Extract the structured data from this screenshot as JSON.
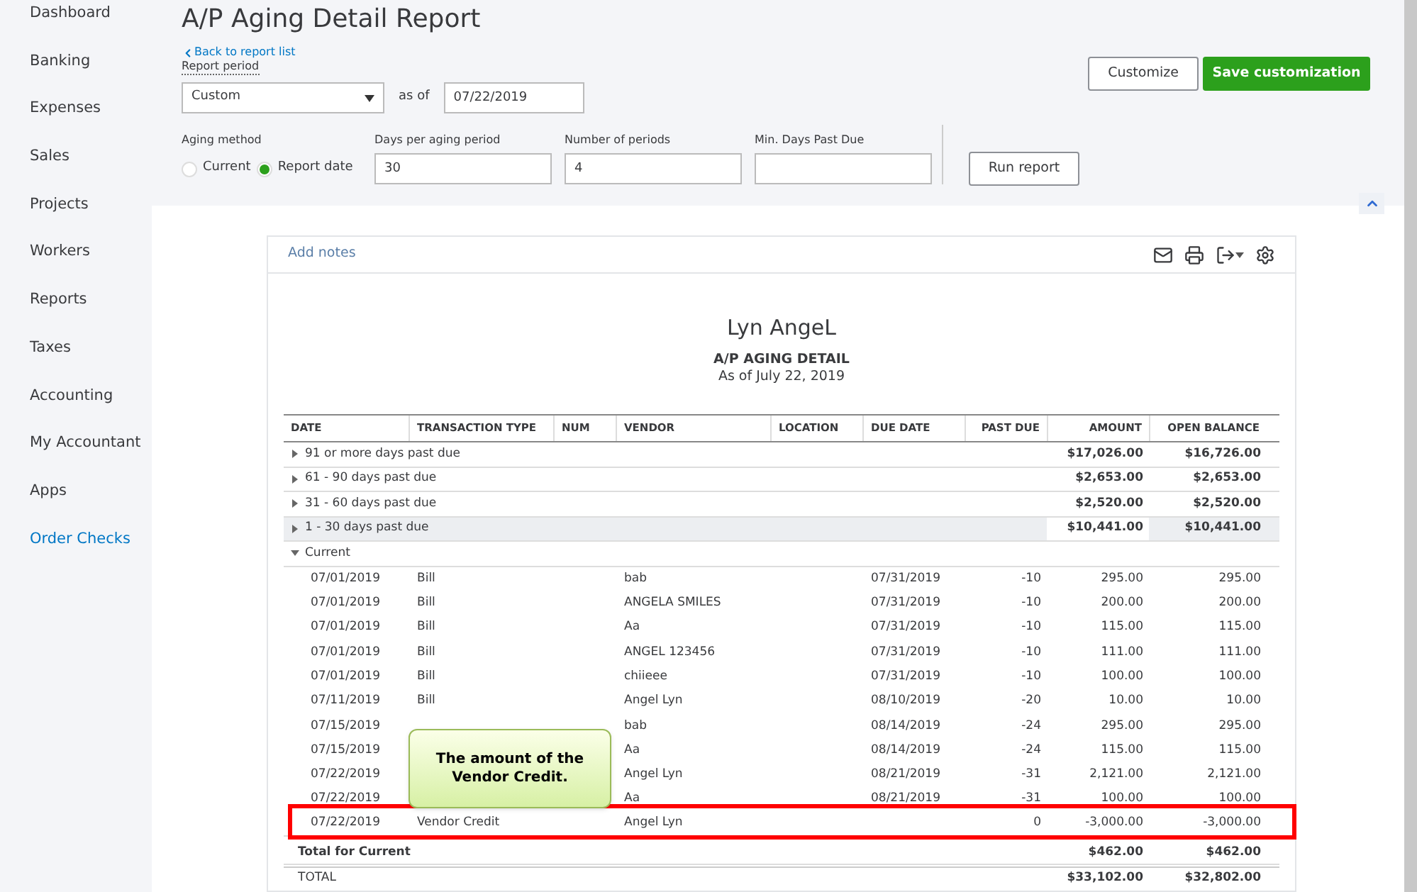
{
  "sidebar": {
    "items": [
      {
        "label": "Dashboard",
        "kind": "nav"
      },
      {
        "label": "Banking",
        "kind": "nav"
      },
      {
        "label": "Expenses",
        "kind": "nav"
      },
      {
        "label": "Sales",
        "kind": "nav"
      },
      {
        "label": "Projects",
        "kind": "nav"
      },
      {
        "label": "Workers",
        "kind": "nav"
      },
      {
        "label": "Reports",
        "kind": "nav"
      },
      {
        "label": "Taxes",
        "kind": "nav"
      },
      {
        "label": "Accounting",
        "kind": "nav"
      },
      {
        "label": "My Accountant",
        "kind": "nav"
      },
      {
        "label": "Apps",
        "kind": "nav"
      },
      {
        "label": "Order Checks",
        "kind": "link"
      }
    ]
  },
  "header": {
    "title": "A/P Aging Detail Report",
    "back_link": "Back to report list",
    "report_period_label": "Report period",
    "period": "Custom",
    "as_of_label": "as of",
    "as_of_date": "07/22/2019",
    "buttons": [
      "Customize",
      "Save customization"
    ]
  },
  "aging": {
    "label": "Aging method",
    "options": [
      {
        "label": "Current",
        "selected": false
      },
      {
        "label": "Report date",
        "selected": true
      }
    ],
    "fields": [
      {
        "label": "Days per aging period",
        "value": "30"
      },
      {
        "label": "Number of periods",
        "value": "4"
      },
      {
        "label": "Min. Days Past Due"
      }
    ],
    "run_button": "Run report"
  },
  "report": {
    "add_notes": "Add notes",
    "company": "Lyn AngeL",
    "title": "A/P AGING DETAIL",
    "subtitle": "As of July 22, 2019",
    "columns": [
      "DATE",
      "TRANSACTION TYPE",
      "NUM",
      "VENDOR",
      "LOCATION",
      "DUE DATE",
      "PAST DUE",
      "AMOUNT",
      "OPEN BALANCE"
    ],
    "groups": [
      {
        "label": "91 or more days past due",
        "expanded": false,
        "highlighted": false,
        "amount": "$17,026.00",
        "open_balance": "$16,726.00"
      },
      {
        "label": "61 - 90 days past due",
        "expanded": false,
        "highlighted": false,
        "amount": "$2,653.00",
        "open_balance": "$2,653.00"
      },
      {
        "label": "31 - 60 days past due",
        "expanded": false,
        "highlighted": false,
        "amount": "$2,520.00",
        "open_balance": "$2,520.00"
      },
      {
        "label": "1 - 30 days past due",
        "expanded": false,
        "highlighted": true,
        "amount": "$10,441.00",
        "open_balance": "$10,441.00"
      },
      {
        "label": "Current",
        "expanded": true,
        "highlighted": false,
        "rows": [
          {
            "date": "07/01/2019",
            "type": "Bill",
            "vendor": "bab",
            "due_date": "07/31/2019",
            "past_due": "-10",
            "amount": "295.00",
            "open_balance": "295.00",
            "highlighted": false
          },
          {
            "date": "07/01/2019",
            "type": "Bill",
            "vendor": "ANGELA SMILES",
            "due_date": "07/31/2019",
            "past_due": "-10",
            "amount": "200.00",
            "open_balance": "200.00",
            "highlighted": false
          },
          {
            "date": "07/01/2019",
            "type": "Bill",
            "vendor": "Aa",
            "due_date": "07/31/2019",
            "past_due": "-10",
            "amount": "115.00",
            "open_balance": "115.00",
            "highlighted": false
          },
          {
            "date": "07/01/2019",
            "type": "Bill",
            "vendor": "ANGEL 123456",
            "due_date": "07/31/2019",
            "past_due": "-10",
            "amount": "111.00",
            "open_balance": "111.00",
            "highlighted": false
          },
          {
            "date": "07/01/2019",
            "type": "Bill",
            "vendor": "chiieee",
            "due_date": "07/31/2019",
            "past_due": "-10",
            "amount": "100.00",
            "open_balance": "100.00",
            "highlighted": false
          },
          {
            "date": "07/11/2019",
            "type": "Bill",
            "vendor": "Angel Lyn",
            "due_date": "08/10/2019",
            "past_due": "-20",
            "amount": "10.00",
            "open_balance": "10.00",
            "highlighted": false
          },
          {
            "date": "07/15/2019",
            "vendor": "bab",
            "due_date": "08/14/2019",
            "past_due": "-24",
            "amount": "295.00",
            "open_balance": "295.00",
            "highlighted": false
          },
          {
            "date": "07/15/2019",
            "vendor": "Aa",
            "due_date": "08/14/2019",
            "past_due": "-24",
            "amount": "115.00",
            "open_balance": "115.00",
            "highlighted": false
          },
          {
            "date": "07/22/2019",
            "vendor": "Angel Lyn",
            "due_date": "08/21/2019",
            "past_due": "-31",
            "amount": "2,121.00",
            "open_balance": "2,121.00",
            "highlighted": false
          },
          {
            "date": "07/22/2019",
            "vendor": "Aa",
            "due_date": "08/21/2019",
            "past_due": "-31",
            "amount": "100.00",
            "open_balance": "100.00",
            "highlighted": false
          },
          {
            "date": "07/22/2019",
            "type": "Vendor Credit",
            "vendor": "Angel Lyn",
            "past_due": "0",
            "amount": "-3,000.00",
            "open_balance": "-3,000.00",
            "highlighted": true
          }
        ],
        "total_label": "Total for Current",
        "total_amount": "$462.00",
        "total_open_balance": "$462.00"
      }
    ],
    "total": {
      "label": "TOTAL",
      "amount": "$33,102.00",
      "open_balance": "$32,802.00"
    }
  },
  "callout": {
    "text": "The amount of the Vendor Credit."
  }
}
